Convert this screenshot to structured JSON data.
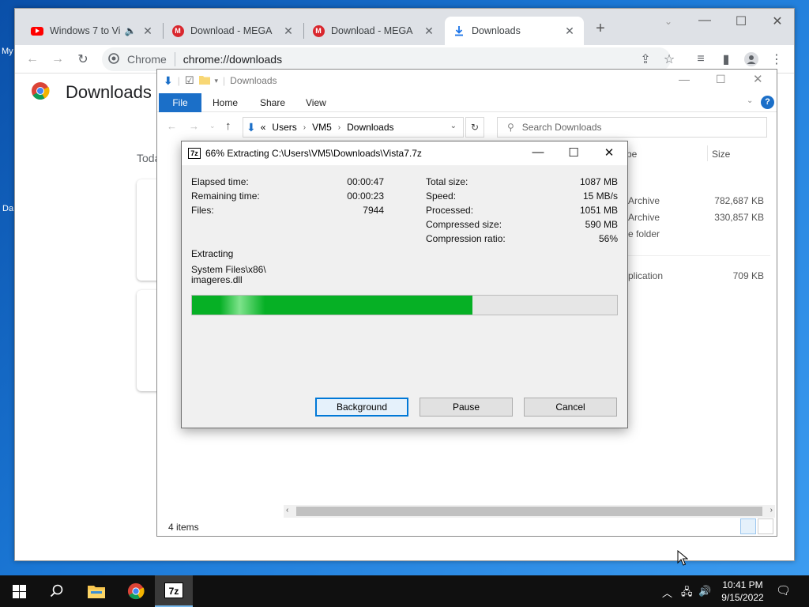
{
  "desktop": {
    "label_1": "My",
    "label_2": "Da"
  },
  "chrome": {
    "tabs": [
      {
        "title": "Windows 7 to Vi",
        "icon": "youtube-icon"
      },
      {
        "title": "Download - MEGA",
        "icon": "mega-icon"
      },
      {
        "title": "Download - MEGA",
        "icon": "mega-icon"
      },
      {
        "title": "Downloads",
        "icon": "download-icon"
      }
    ],
    "omnibox": {
      "scheme_label": "Chrome",
      "url": "chrome://downloads"
    },
    "page_title": "Downloads",
    "section_today": "Toda"
  },
  "explorer": {
    "title": "Downloads",
    "ribbon_tabs": [
      "File",
      "Home",
      "Share",
      "View"
    ],
    "breadcrumb": {
      "prefix": "«",
      "items": [
        "Users",
        "VM5",
        "Downloads"
      ]
    },
    "search_placeholder": "Search Downloads",
    "columns": {
      "type": "pe",
      "size": "Size"
    },
    "rows": [
      {
        "type": "Archive",
        "size": "782,687 KB"
      },
      {
        "type": "Archive",
        "size": "330,857 KB"
      },
      {
        "type": "e folder",
        "size": ""
      },
      {
        "type": "plication",
        "size": "709 KB"
      }
    ],
    "status": "4 items"
  },
  "zip": {
    "title": "66% Extracting C:\\Users\\VM5\\Downloads\\Vista7.7z",
    "left_stats": [
      {
        "label": "Elapsed time:",
        "value": "00:00:47"
      },
      {
        "label": "Remaining time:",
        "value": "00:00:23"
      },
      {
        "label": "Files:",
        "value": "7944"
      }
    ],
    "right_stats": [
      {
        "label": "Total size:",
        "value": "1087 MB"
      },
      {
        "label": "Speed:",
        "value": "15 MB/s"
      },
      {
        "label": "Processed:",
        "value": "1051 MB"
      },
      {
        "label": "Compressed size:",
        "value": "590 MB"
      },
      {
        "label": "Compression ratio:",
        "value": "56%"
      }
    ],
    "operation": "Extracting",
    "current_path": "System Files\\x86\\",
    "current_file": "imageres.dll",
    "progress_percent": 66,
    "buttons": {
      "background": "Background",
      "pause": "Pause",
      "cancel": "Cancel"
    }
  },
  "taskbar": {
    "time": "10:41 PM",
    "date": "9/15/2022"
  },
  "colors": {
    "progress": "#06b025",
    "accent": "#1b6fc8",
    "taskbar": "#101010"
  }
}
